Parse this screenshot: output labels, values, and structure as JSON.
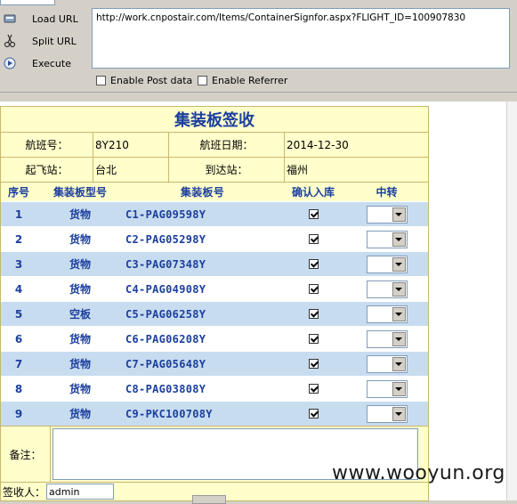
{
  "toolbar": {
    "load_url": "Load URL",
    "split_url": "Split URL",
    "execute": "Execute",
    "url_value": "http://work.cnpostair.com/Items/ContainerSignfor.aspx?FLIGHT_ID=100907830",
    "enable_post_data": "Enable Post data",
    "enable_referrer": "Enable Referrer"
  },
  "form": {
    "title": "集装板签收",
    "flight_no_label": "航班号：",
    "flight_no": "8Y210",
    "flight_date_label": "航班日期：",
    "flight_date": "2014-12-30",
    "departure_label": "起飞站：",
    "departure": "台北",
    "arrival_label": "到达站：",
    "arrival": "福州",
    "columns": [
      "序号",
      "集装板型号",
      "集装板号",
      "确认入库",
      "中转"
    ],
    "rows": [
      {
        "no": "1",
        "type": "货物",
        "id": "C1-PAG09598Y"
      },
      {
        "no": "2",
        "type": "货物",
        "id": "C2-PAG05298Y"
      },
      {
        "no": "3",
        "type": "货物",
        "id": "C3-PAG07348Y"
      },
      {
        "no": "4",
        "type": "货物",
        "id": "C4-PAG04908Y"
      },
      {
        "no": "5",
        "type": "空板",
        "id": "C5-PAG06258Y"
      },
      {
        "no": "6",
        "type": "货物",
        "id": "C6-PAG06208Y"
      },
      {
        "no": "7",
        "type": "货物",
        "id": "C7-PAG05648Y"
      },
      {
        "no": "8",
        "type": "货物",
        "id": "C8-PAG03808Y"
      },
      {
        "no": "9",
        "type": "货物",
        "id": "C9-PKC100708Y"
      }
    ],
    "remark_label": "备注：",
    "signer_label": "签收人：",
    "signer_value": "admin"
  },
  "watermark": "www.wooyun.org"
}
